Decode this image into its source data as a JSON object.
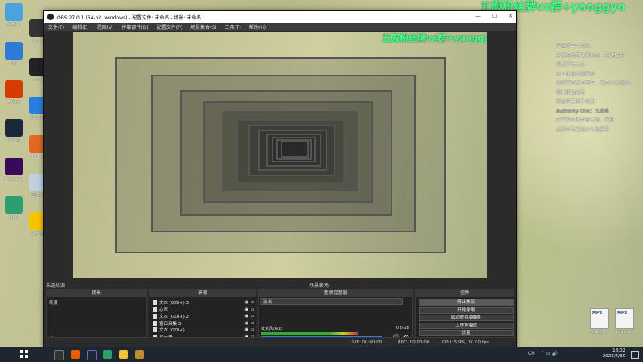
{
  "overlay": {
    "watermark": "五殿粉丝牌vx群+yaoggyo"
  },
  "notes": {
    "lines": [
      "送出弹幕可点击",
      "左键拖动可改变位置，左键拉伸",
      "调整字体大小",
      "右上角有设置菜单",
      "设置里有显示弹幕、表情开关/设置、",
      "粗体和描边等",
      "添加弹幕助手成功",
      "Authority One：九点来",
      "",
      "这里展示收到的礼物、通知",
      "",
      "点菜单可设置小礼物屏蔽"
    ]
  },
  "desktop_icons": [
    {
      "label": "此电脑",
      "color": "#4aa3df"
    },
    {
      "label": "QQ",
      "color": "#2e7bd6"
    },
    {
      "label": "Adobe",
      "color": "#d83b01"
    },
    {
      "label": "Steam",
      "color": "#1b2838"
    },
    {
      "label": "Premiere",
      "color": "#3a0a5a"
    },
    {
      "label": "Edge",
      "color": "#2f9e6e"
    },
    {
      "label": "Unity",
      "color": "#333"
    },
    {
      "label": "OBS",
      "color": "#222"
    },
    {
      "label": "Chrome",
      "color": "#2a7de1"
    },
    {
      "label": "Office",
      "color": "#e3681f"
    },
    {
      "label": "回收站",
      "color": "#c0d0e0"
    },
    {
      "label": "QQ音乐",
      "color": "#f5c400"
    }
  ],
  "desktop_files": [
    {
      "tag": "MP3",
      "label": "yoasobi"
    },
    {
      "tag": "MP3",
      "label": "yoasobi"
    }
  ],
  "obs": {
    "title": "OBS 27.0.1 (64-bit, windows) - 配置文件: 未命名 - 场景: 未命名",
    "menu": [
      "文件(F)",
      "编辑(E)",
      "视图(V)",
      "停靠部件(D)",
      "配置文件(P)",
      "场景集合(S)",
      "工具(T)",
      "帮助(H)"
    ],
    "scene_strip": "未选择源",
    "docks": {
      "scenes": {
        "header": "场景",
        "items": [
          "场景"
        ]
      },
      "sources": {
        "header": "来源",
        "items": [
          "文本 (GDI+) 3",
          "心率",
          "文本 (GDI+) 2",
          "窗口采集 3",
          "文本 (GDI+)",
          "显示器"
        ]
      },
      "transitions": {
        "header": "音频混音器",
        "track_name": "麦克风/Aux",
        "track_db": "0.0 dB"
      },
      "scene_transitions": {
        "header": "场景转场",
        "mode": "淡出"
      },
      "controls": {
        "header": "控件",
        "buttons": [
          "停止推流",
          "开始录制",
          "启动虚拟摄像机",
          "工作室模式",
          "设置",
          "退出"
        ]
      }
    },
    "status": {
      "live": "LIVE: 00:00:00",
      "rec": "REC: 00:00:00",
      "cpu": "CPU: 5.9%, 30.00 fps"
    }
  },
  "taskbar": {
    "time": "18:02",
    "date": "2022/4/30",
    "tray": "CN"
  },
  "colors": {
    "watermark": "#44ff88",
    "obs_bg": "#2b2b2b",
    "taskbar": "#1e2630"
  }
}
